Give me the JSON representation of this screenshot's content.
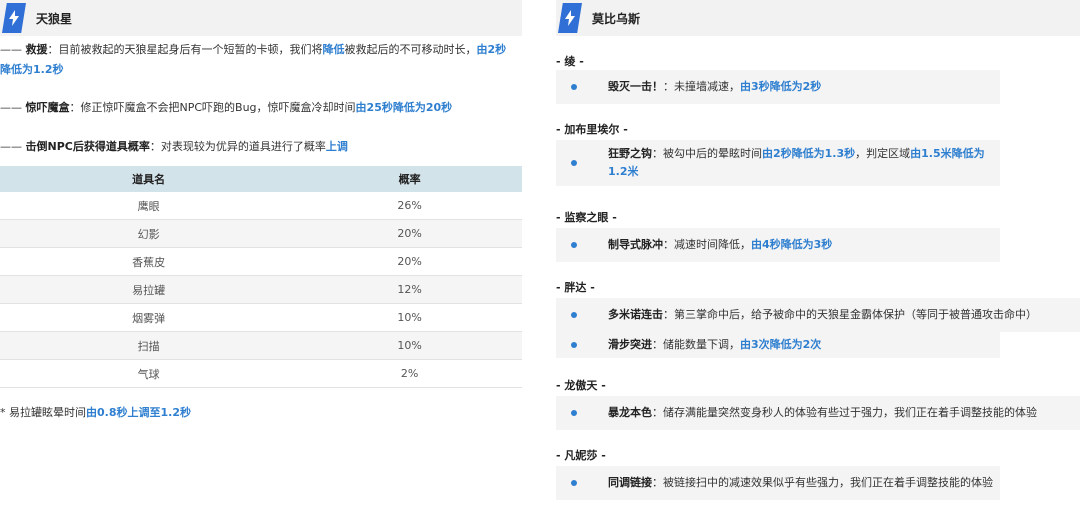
{
  "left": {
    "title": "天狼星",
    "p1": {
      "dash": "—— ",
      "label": "救援",
      "colon": "：",
      "text1": "目前被救起的天狼星起身后有一个短暂的卡顿，我们将",
      "hl1": "降低",
      "text2": "被救起后的不可移动时长，",
      "hl2a": "由2秒",
      "hl2b": "降低为1.2秒"
    },
    "p2": {
      "dash": "—— ",
      "label": "惊吓魔盒",
      "colon": "：",
      "text": "修正惊吓魔盒不会把NPC吓跑的Bug，惊吓魔盒冷却时间",
      "hl": "由25秒降低为20秒"
    },
    "p3": {
      "dash": "—— ",
      "label": "击倒NPC后获得道具概率",
      "colon": "：",
      "text": "对表现较为优异的道具进行了概率",
      "hl": "上调"
    },
    "table": {
      "h1": "道具名",
      "h2": "概率",
      "rows": [
        {
          "name": "鹰眼",
          "p": "26%"
        },
        {
          "name": "幻影",
          "p": "20%"
        },
        {
          "name": "香蕉皮",
          "p": "20%"
        },
        {
          "name": "易拉罐",
          "p": "12%"
        },
        {
          "name": "烟雾弹",
          "p": "10%"
        },
        {
          "name": "扫描",
          "p": "10%"
        },
        {
          "name": "气球",
          "p": "2%"
        }
      ]
    },
    "note": {
      "text": "* 易拉罐眩晕时间",
      "hl": "由0.8秒上调至1.2秒"
    }
  },
  "right": {
    "title": "莫比乌斯",
    "heroes": [
      {
        "name": "- 绫 -",
        "items": [
          {
            "label": "毁灭一击！",
            "sep": "：",
            "text": "未撞墙减速，",
            "hl": "由3秒降低为2秒"
          }
        ]
      },
      {
        "name": "- 加布里埃尔 -",
        "items": [
          {
            "label": "狂野之钩",
            "sep": "：",
            "text": "被勾中后的晕眩时间",
            "hl": "由2秒降低为1.3秒",
            "text2": "，判定区域",
            "hl2a": "由1.5米降低为",
            "hl2b": "1.2米"
          }
        ]
      },
      {
        "name": "- 监察之眼 -",
        "items": [
          {
            "label": "制导式脉冲",
            "sep": "：",
            "text": "减速时间降低，",
            "hl": "由4秒降低为3秒"
          }
        ]
      },
      {
        "name": "- 胖达 -",
        "items": [
          {
            "label": "多米诺连击",
            "sep": "：",
            "text": "第三掌命中后，给予被命中的天狼星金霸体保护（等同于被普通攻击命中）"
          },
          {
            "label": "滑步突进",
            "sep": "：",
            "text": "储能数量下调，",
            "hl": "由3次降低为2次"
          }
        ]
      },
      {
        "name": "- 龙傲天 -",
        "items": [
          {
            "label": "暴龙本色",
            "sep": "：",
            "text": "储存满能量突然变身秒人的体验有些过于强力，我们正在着手调整技能的体验"
          }
        ]
      },
      {
        "name": "- 凡妮莎 -",
        "items": [
          {
            "label": "同调链接",
            "sep": "：",
            "text": "被链接扫中的减速效果似乎有些强力，我们正在着手调整技能的体验"
          }
        ]
      }
    ]
  },
  "colors": {
    "accent": "#2f7fd0",
    "header_bg": "#f2f2f2",
    "table_head": "#d3e3ea",
    "bolt": "#2f6fd6"
  },
  "icons": {
    "section": "lightning-bolt-icon",
    "bullet": "bullet-dot-icon"
  }
}
